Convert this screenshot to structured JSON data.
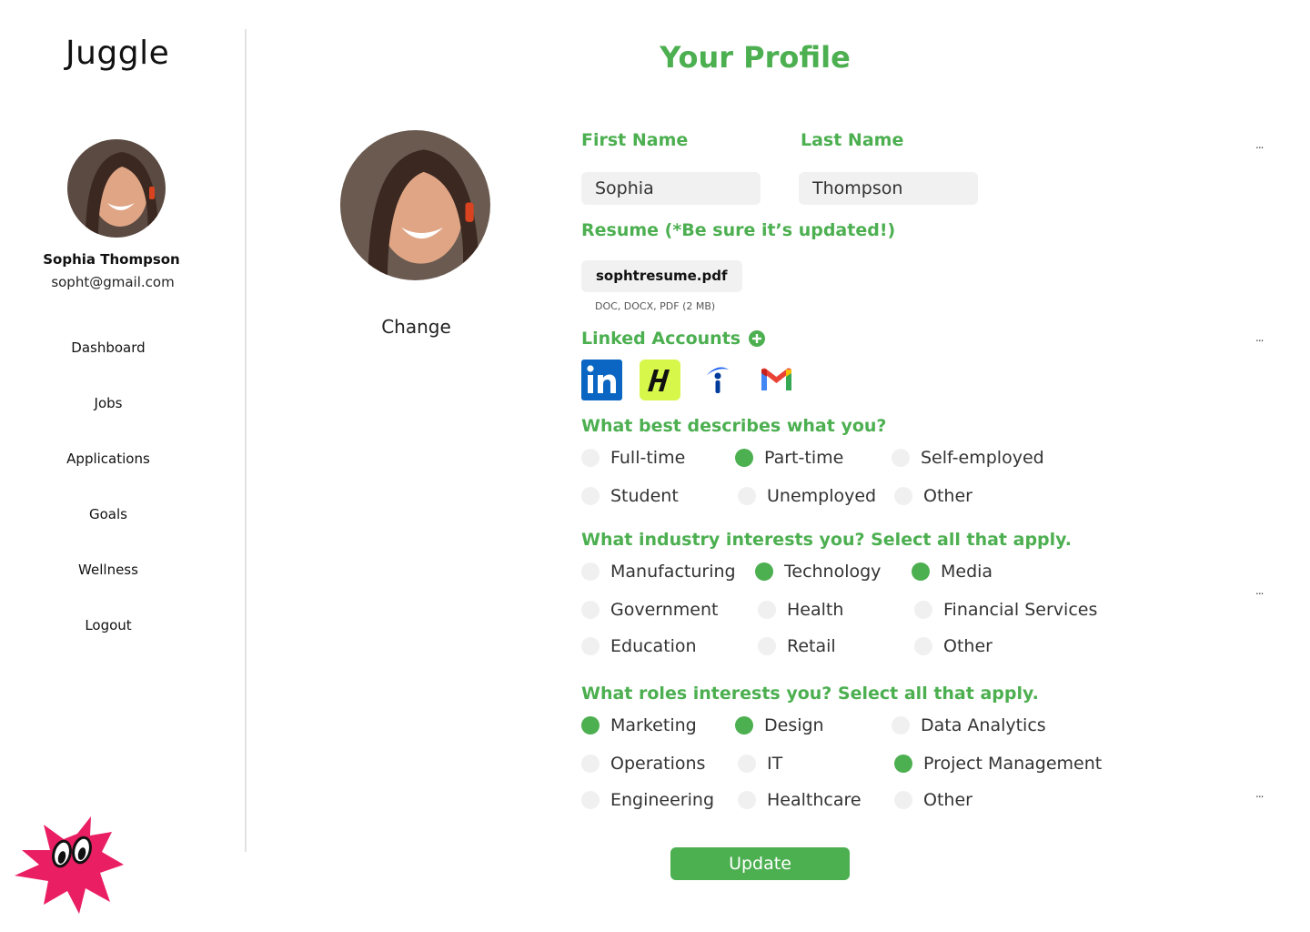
{
  "app": {
    "logo": "Juggle"
  },
  "sidebar": {
    "user_name": "Sophia Thompson",
    "user_email": "sopht@gmail.com",
    "nav": [
      "Dashboard",
      "Jobs",
      "Applications",
      "Goals",
      "Wellness",
      "Logout"
    ]
  },
  "main": {
    "title": "Your Profile",
    "change_label": "Change",
    "first_name_label": "First Name",
    "last_name_label": "Last Name",
    "first_name_value": "Sophia",
    "last_name_value": "Thompson",
    "resume_label": "Resume (*Be sure it’s updated!)",
    "resume_file": "sophtresume.pdf",
    "resume_hint": "DOC, DOCX, PDF (2 MB)",
    "linked_accounts_label": "Linked Accounts",
    "linked_accounts": [
      "linkedin-icon",
      "handshake-icon",
      "indeed-icon",
      "gmail-icon"
    ],
    "more_menu": "...",
    "employment_question": "What best describes what you?",
    "employment_options": [
      {
        "label": "Full-time",
        "selected": false
      },
      {
        "label": "Part-time",
        "selected": true
      },
      {
        "label": "Self-employed",
        "selected": false
      },
      {
        "label": "Student",
        "selected": false
      },
      {
        "label": "Unemployed",
        "selected": false
      },
      {
        "label": "Other",
        "selected": false
      }
    ],
    "industry_question": "What industry interests you? Select all that apply.",
    "industry_options": [
      {
        "label": "Manufacturing",
        "selected": false
      },
      {
        "label": "Technology",
        "selected": true
      },
      {
        "label": "Media",
        "selected": true
      },
      {
        "label": "Government",
        "selected": false
      },
      {
        "label": "Health",
        "selected": false
      },
      {
        "label": "Financial Services",
        "selected": false
      },
      {
        "label": "Education",
        "selected": false
      },
      {
        "label": "Retail",
        "selected": false
      },
      {
        "label": "Other",
        "selected": false
      }
    ],
    "roles_question": "What roles interests you? Select all that apply.",
    "role_options": [
      {
        "label": "Marketing",
        "selected": true
      },
      {
        "label": "Design",
        "selected": true
      },
      {
        "label": "Data Analytics",
        "selected": false
      },
      {
        "label": "Operations",
        "selected": false
      },
      {
        "label": "IT",
        "selected": false
      },
      {
        "label": "Project Management",
        "selected": true
      },
      {
        "label": "Engineering",
        "selected": false
      },
      {
        "label": "Healthcare",
        "selected": false
      },
      {
        "label": "Other",
        "selected": false
      }
    ],
    "update_label": "Update"
  },
  "colors": {
    "accent": "#4caf50",
    "mascot": "#e91e63",
    "input_bg": "#f1f1f1"
  }
}
